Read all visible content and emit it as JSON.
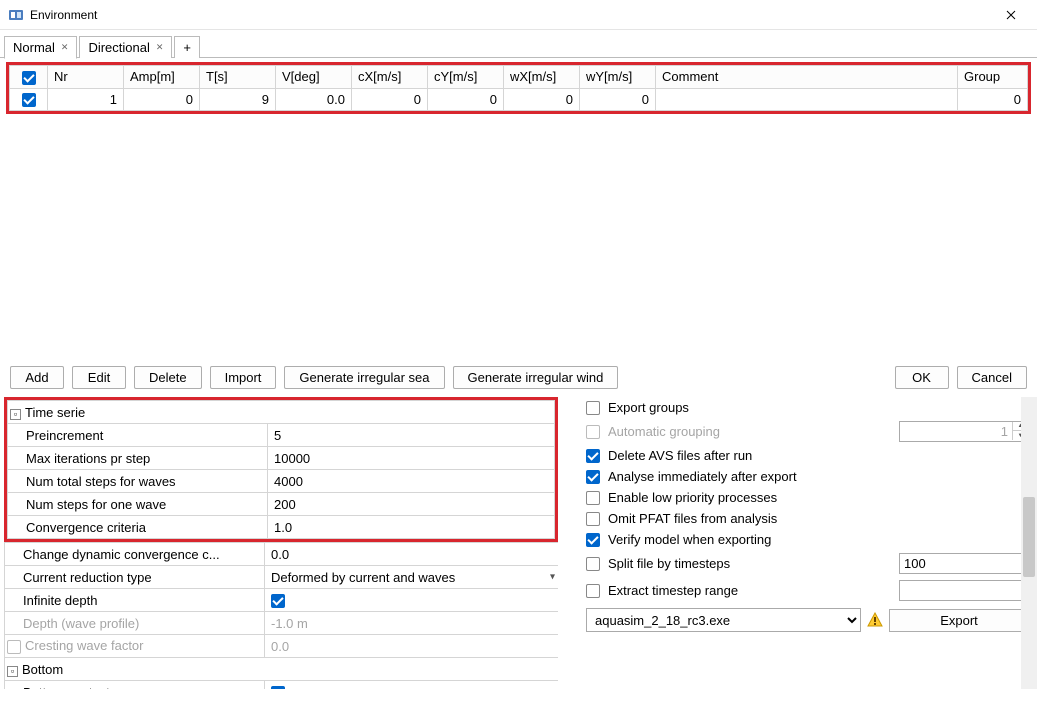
{
  "window": {
    "title": "Environment"
  },
  "tabs": [
    {
      "label": "Normal",
      "active": true
    },
    {
      "label": "Directional",
      "active": false
    }
  ],
  "grid": {
    "headers": [
      "Nr",
      "Amp[m]",
      "T[s]",
      "V[deg]",
      "cX[m/s]",
      "cY[m/s]",
      "wX[m/s]",
      "wY[m/s]",
      "Comment",
      "Group"
    ],
    "row": {
      "nr": "1",
      "amp": "0",
      "t": "9",
      "v": "0.0",
      "cx": "0",
      "cy": "0",
      "wx": "0",
      "wy": "0",
      "comment": "",
      "group": "0"
    }
  },
  "toolbar": {
    "add": "Add",
    "edit": "Edit",
    "delete": "Delete",
    "import": "Import",
    "gensea": "Generate irregular sea",
    "genwind": "Generate irregular wind",
    "ok": "OK",
    "cancel": "Cancel"
  },
  "timeserie": {
    "section": "Time serie",
    "preincrement_label": "Preincrement",
    "preincrement": "5",
    "maxiter_label": "Max iterations pr step",
    "maxiter": "10000",
    "numtotal_label": "Num total steps for waves",
    "numtotal": "4000",
    "numone_label": "Num steps for one wave",
    "numone": "200",
    "conv_label": "Convergence criteria",
    "conv": "1.0"
  },
  "extra": {
    "changedyn_label": "Change dynamic convergence c...",
    "changedyn": "0.0",
    "curred_label": "Current reduction type",
    "curred": "Deformed by current and waves",
    "infdepth_label": "Infinite depth",
    "depth_label": "Depth (wave profile)",
    "depth": "-1.0 m",
    "cresting_label": "Cresting wave factor",
    "cresting": "0.0",
    "bottom_section": "Bottom",
    "bottomcontact_label": "Bottom contact"
  },
  "options": {
    "exportgroups": "Export groups",
    "autogrouping": "Automatic grouping",
    "autogrouping_val": "1",
    "deleteavs": "Delete AVS files after run",
    "analyse": "Analyse immediately after export",
    "lowprio": "Enable low priority processes",
    "omitpfat": "Omit PFAT files from analysis",
    "verify": "Verify model when exporting",
    "splitfile": "Split file by timesteps",
    "splitfile_val": "100",
    "extractrange": "Extract timestep range",
    "extractrange_val": "",
    "exe": "aquasim_2_18_rc3.exe",
    "export": "Export"
  }
}
